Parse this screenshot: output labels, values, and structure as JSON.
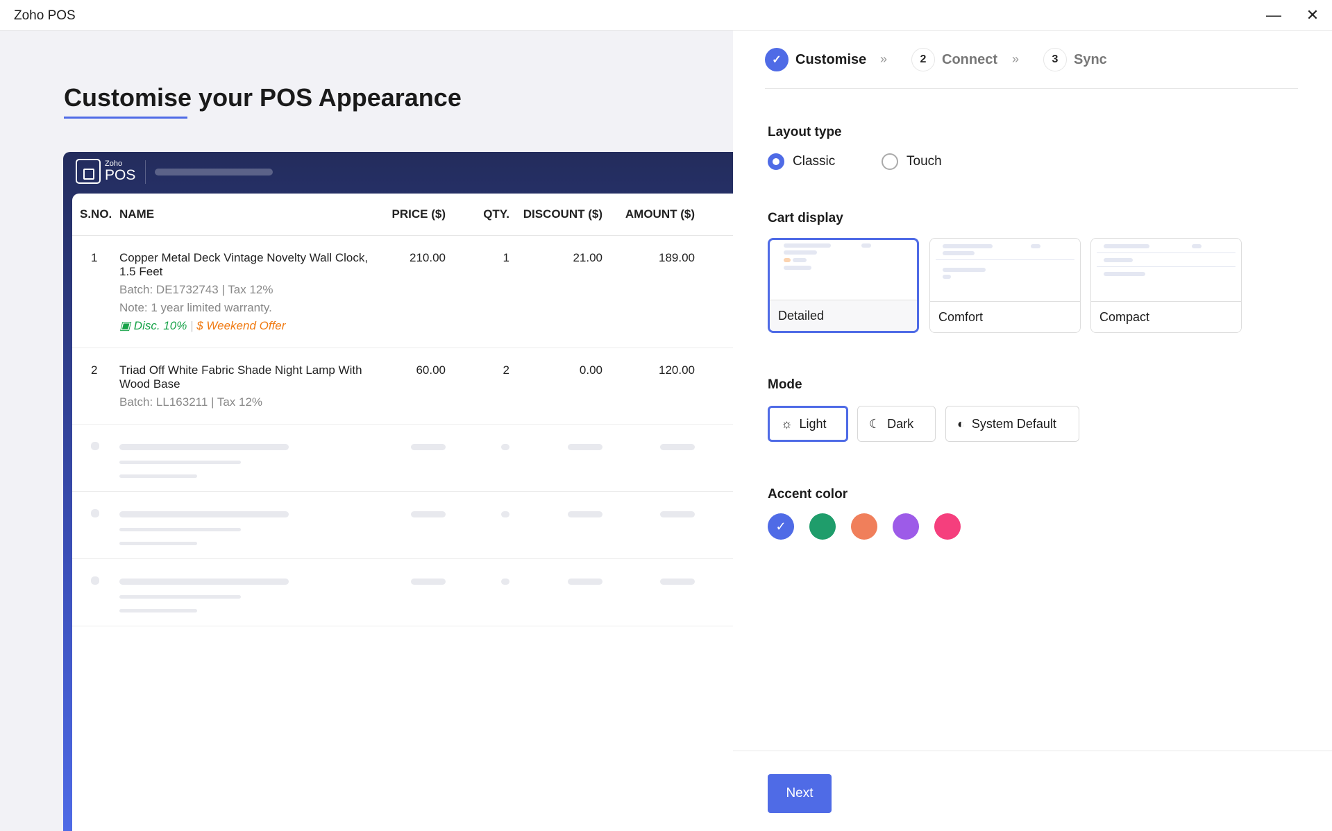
{
  "window": {
    "title": "Zoho POS",
    "minimize": "—",
    "close": "✕"
  },
  "preview": {
    "heading": "Customise your POS Appearance",
    "logo_small": "Zoho",
    "logo_big": "POS",
    "columns": [
      "S.NO.",
      "NAME",
      "PRICE ($)",
      "QTY.",
      "DISCOUNT ($)",
      "AMOUNT ($)"
    ],
    "rows": [
      {
        "sno": "1",
        "name": "Copper Metal Deck Vintage Novelty Wall Clock, 1.5 Feet",
        "batch": "Batch: DE1732743 | Tax 12%",
        "note": "Note: 1 year limited warranty.",
        "disc": "Disc. 10%",
        "offer": "Weekend Offer",
        "price": "210.00",
        "qty": "1",
        "discount": "21.00",
        "amount": "189.00"
      },
      {
        "sno": "2",
        "name": "Triad Off White Fabric Shade Night Lamp With Wood Base",
        "batch": "Batch: LL163211 | Tax 12%",
        "price": "60.00",
        "qty": "2",
        "discount": "0.00",
        "amount": "120.00"
      }
    ]
  },
  "stepper": [
    {
      "label": "Customise",
      "state": "done"
    },
    {
      "num": "2",
      "label": "Connect"
    },
    {
      "num": "3",
      "label": "Sync"
    }
  ],
  "layout": {
    "label": "Layout type",
    "options": [
      "Classic",
      "Touch"
    ],
    "selected": "Classic"
  },
  "cart": {
    "label": "Cart display",
    "options": [
      "Detailed",
      "Comfort",
      "Compact"
    ],
    "selected": "Detailed"
  },
  "mode": {
    "label": "Mode",
    "options": [
      "Light",
      "Dark",
      "System Default"
    ],
    "selected": "Light"
  },
  "accent": {
    "label": "Accent color",
    "colors": [
      "#4f6be6",
      "#1f9d6b",
      "#f07f5b",
      "#9d5be8",
      "#f53f7d"
    ],
    "selected": "#4f6be6"
  },
  "next_label": "Next"
}
